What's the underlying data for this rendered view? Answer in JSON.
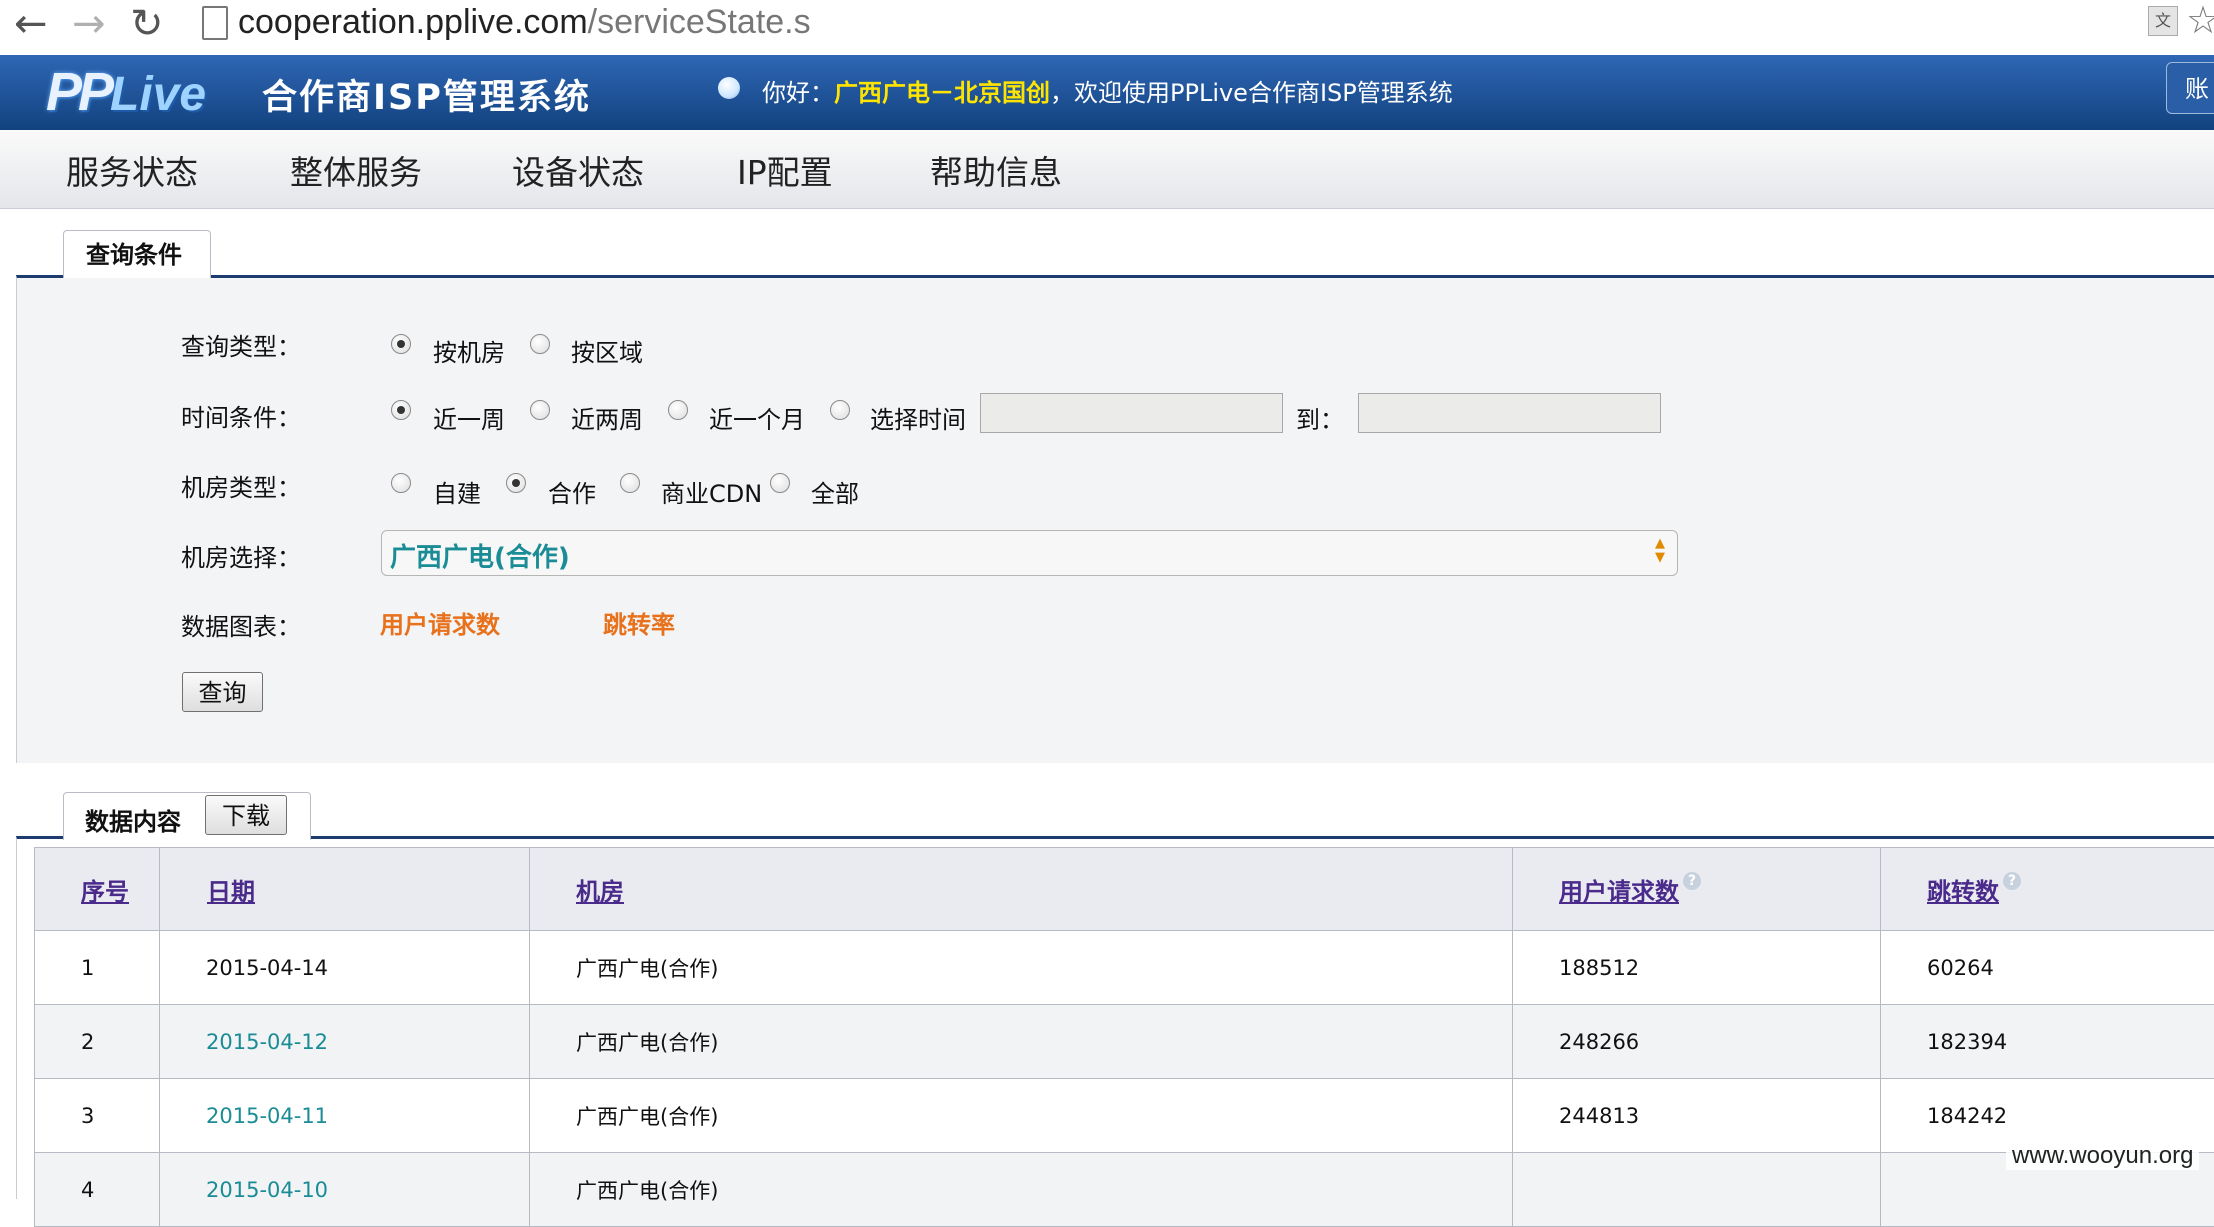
{
  "browser": {
    "url_host": "cooperation.pplive.com",
    "url_path": "/serviceState.s"
  },
  "header": {
    "logo_pp": "PP",
    "logo_live": "Live",
    "system_title": "合作商ISP管理系统",
    "greeting_prefix": "你好：",
    "greeting_org": "广西广电－北京国创",
    "greeting_suffix": "，欢迎使用PPLive合作商ISP管理系统",
    "account_label": "账"
  },
  "menu": {
    "items": [
      "服务状态",
      "整体服务",
      "设备状态",
      "IP配置",
      "帮助信息"
    ]
  },
  "query": {
    "tab_label": "查询条件",
    "query_type_label": "查询类型：",
    "query_type_options": [
      "按机房",
      "按区域"
    ],
    "time_label": "时间条件：",
    "time_options": [
      "近一周",
      "近两周",
      "近一个月",
      "选择时间"
    ],
    "to_label": "到：",
    "start_date": "",
    "end_date": "",
    "room_type_label": "机房类型：",
    "room_type_options": [
      "自建",
      "合作",
      "商业CDN",
      "全部"
    ],
    "room_select_label": "机房选择：",
    "room_selected": "广西广电(合作)",
    "chart_label": "数据图表：",
    "chart_links": [
      "用户请求数",
      "跳转率"
    ],
    "submit_label": "查询"
  },
  "data": {
    "tab_label": "数据内容",
    "download_label": "下载",
    "columns": [
      "序号",
      "日期",
      "机房",
      "用户请求数",
      "跳转数"
    ],
    "rows": [
      [
        "1",
        "2015-04-14",
        "广西广电(合作)",
        "188512",
        "60264"
      ],
      [
        "2",
        "2015-04-12",
        "广西广电(合作)",
        "248266",
        "182394"
      ],
      [
        "3",
        "2015-04-11",
        "广西广电(合作)",
        "244813",
        "184242"
      ],
      [
        "4",
        "2015-04-10",
        "广西广电(合作)",
        "",
        ""
      ]
    ]
  },
  "watermark": "www.wooyun.org"
}
